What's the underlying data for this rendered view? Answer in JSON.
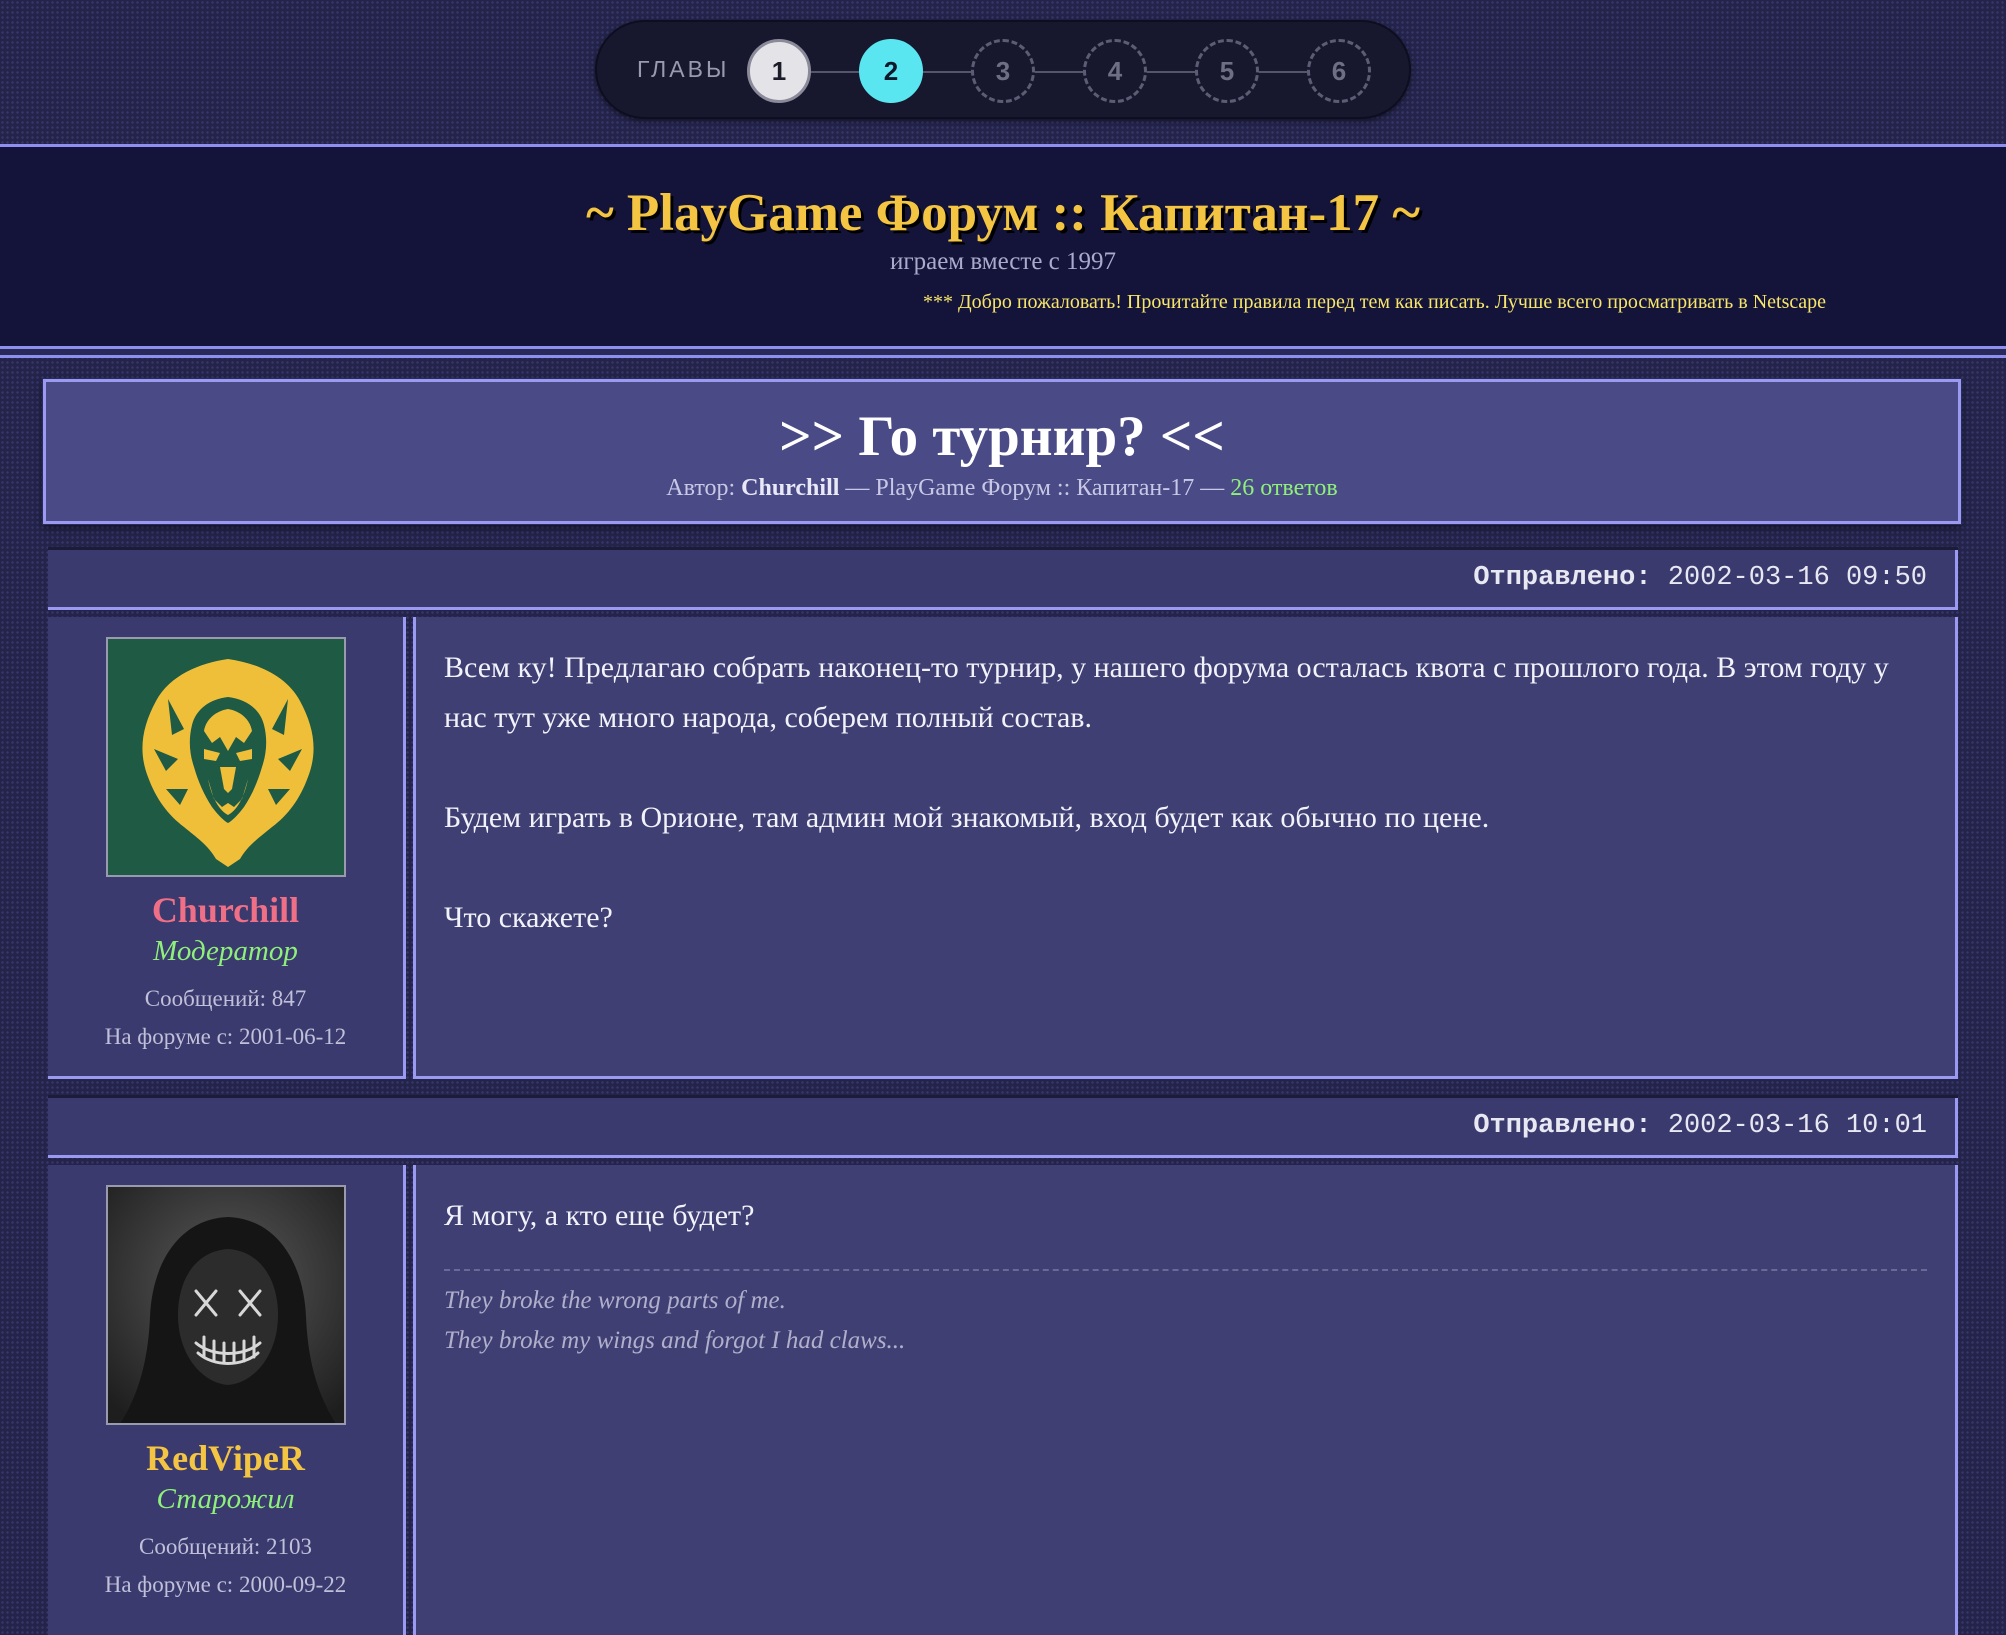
{
  "chapters": {
    "label": "ГЛАВЫ",
    "items": [
      {
        "label": "1",
        "state": "done"
      },
      {
        "label": "2",
        "state": "active"
      },
      {
        "label": "3",
        "state": "todo"
      },
      {
        "label": "4",
        "state": "todo"
      },
      {
        "label": "5",
        "state": "todo"
      },
      {
        "label": "6",
        "state": "todo"
      }
    ]
  },
  "site": {
    "title": "~ PlayGame Форум :: Капитан-17 ~",
    "subtitle": "играем вместе с 1997",
    "marquee": "*** Добро пожаловать! Прочитайте правила перед тем как писать. Лучше всего просматривать в Netscape"
  },
  "thread": {
    "title": ">> Го турнир? <<",
    "author_label": "Автор:",
    "author": "Churchill",
    "forum": "— PlayGame Форум :: Капитан-17 —",
    "replies": "26 ответов"
  },
  "posts": [
    {
      "date_label": "Отправлено:",
      "date": "2002-03-16 09:50",
      "user": {
        "name": "Churchill",
        "name_color": "#ee6f86",
        "rank": "Модератор",
        "posts": "Сообщений: 847",
        "joined": "На форуме с: 2001-06-12",
        "avatar_icon": "lion-icon"
      },
      "paragraphs": [
        "Всем ку! Предлагаю собрать наконец-то турнир, у нашего форума осталась квота с прошлого года. В этом году у нас тут уже много народа, соберем полный состав.",
        "Будем играть в Орионе, там админ мой знакомый, вход будет как обычно по цене.",
        "Что скажете?"
      ]
    },
    {
      "date_label": "Отправлено:",
      "date": "2002-03-16 10:01",
      "user": {
        "name": "RedVipeR",
        "name_color": "#f4c542",
        "rank": "Старожил",
        "posts": "Сообщений: 2103",
        "joined": "На форуме с: 2000-09-22",
        "avatar_icon": "hooded-mask-icon"
      },
      "paragraphs": [
        "Я могу, а кто еще будет?"
      ],
      "signature": [
        "They broke the wrong parts of me.",
        "They broke my wings and forgot I had claws..."
      ]
    }
  ]
}
